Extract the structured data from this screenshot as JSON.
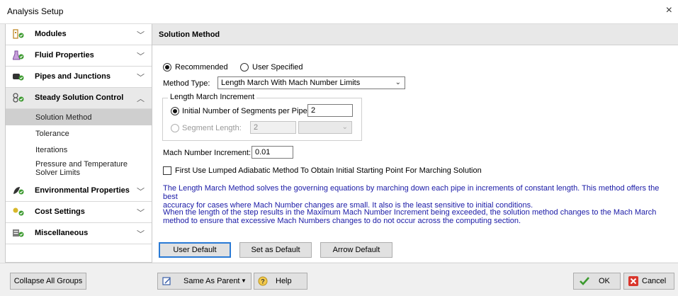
{
  "window": {
    "title": "Analysis Setup",
    "close_glyph": "×"
  },
  "sidebar": {
    "groups": [
      {
        "label": "Modules",
        "icon": "modules-icon",
        "chevron": "﹀"
      },
      {
        "label": "Fluid Properties",
        "icon": "flask-icon",
        "chevron": "﹀"
      },
      {
        "label": "Pipes and Junctions",
        "icon": "pipe-icon",
        "chevron": "﹀"
      },
      {
        "label": "Steady Solution Control",
        "icon": "solution-control-icon",
        "chevron": "︿"
      },
      {
        "label": "Environmental Properties",
        "icon": "environment-icon",
        "chevron": "﹀"
      },
      {
        "label": "Cost Settings",
        "icon": "cost-icon",
        "chevron": "﹀"
      },
      {
        "label": "Miscellaneous",
        "icon": "misc-icon",
        "chevron": "﹀"
      }
    ],
    "subitems": [
      {
        "label": "Solution Method"
      },
      {
        "label": "Tolerance"
      },
      {
        "label": "Iterations"
      },
      {
        "label": "Pressure and Temperature Solver Limits"
      }
    ]
  },
  "panel": {
    "header": "Solution Method",
    "radio_recommended": "Recommended",
    "radio_user_specified": "User Specified",
    "method_type_label": "Method Type:",
    "method_type_value": "Length March With Mach Number Limits",
    "lmi_legend": "Length March Increment",
    "initial_segments_label": "Initial Number of Segments per Pipe:",
    "initial_segments_value": "2",
    "segment_length_label": "Segment Length:",
    "segment_length_value": "2",
    "mach_increment_label": "Mach Number Increment:",
    "mach_increment_value": "0.01",
    "lumped_checkbox_label": "First Use Lumped Adiabatic Method To Obtain Initial Starting Point For Marching Solution",
    "desc1_line1": "The Length March Method solves the governing equations by marching down each pipe in increments of constant length. This method offers the best",
    "desc1_line2": "accuracy for cases where Mach Number changes are small. It also is the least sensitive to initial conditions.",
    "desc2_line1": "When the length of the step results in the Maximum Mach Number Increment being exceeded, the solution method changes to the Mach March",
    "desc2_line2": "method to ensure that excessive Mach Numbers changes to do not occur across the computing section.",
    "btn_user_default": "User Default",
    "btn_set_default": "Set as Default",
    "btn_arrow_default": "Arrow Default"
  },
  "footer": {
    "collapse_all": "Collapse All Groups",
    "same_as_parent": "Same As Parent",
    "help": "Help",
    "ok": "OK",
    "cancel": "Cancel"
  },
  "colors": {
    "accent_blue": "#1a1aa6",
    "ok_green": "#3c9a2f",
    "cancel_red": "#d9352b",
    "focus_border": "#2a7ad5"
  }
}
